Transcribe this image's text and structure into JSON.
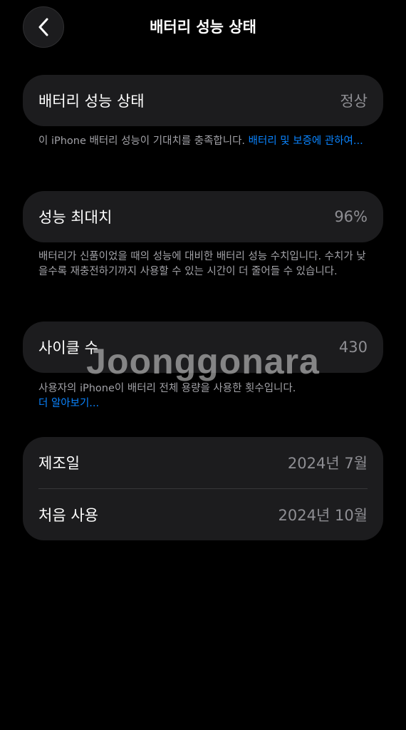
{
  "nav": {
    "title": "배터리 성능 상태",
    "back_icon": "chevron-left-icon"
  },
  "battery_health": {
    "label": "배터리 성능 상태",
    "value": "정상",
    "note_text": "이 iPhone 배터리 성능이 기대치를 충족합니다. ",
    "note_link": "배터리 및 보증에 관하여..."
  },
  "max_capacity": {
    "label": "성능 최대치",
    "value": "96%",
    "note_text": "배터리가 신품이었을 때의 성능에 대비한 배터리 성능 수치입니다. 수치가 낮을수록 재충전하기까지 사용할 수 있는 시간이 더 줄어들 수 있습니다."
  },
  "cycle_count": {
    "label": "사이클 수",
    "value": "430",
    "note_text": "사용자의 iPhone이 배터리 전체 용량을 사용한 횟수입니다.",
    "note_link": "더 알아보기..."
  },
  "dates": {
    "manufacture_label": "제조일",
    "manufacture_value": "2024년 7월",
    "first_use_label": "처음 사용",
    "first_use_value": "2024년 10월"
  },
  "watermark": "Joonggonara",
  "colors": {
    "background": "#000000",
    "card": "#1c1c1e",
    "link": "#0a84ff",
    "secondary_text": "#8e8e93"
  }
}
